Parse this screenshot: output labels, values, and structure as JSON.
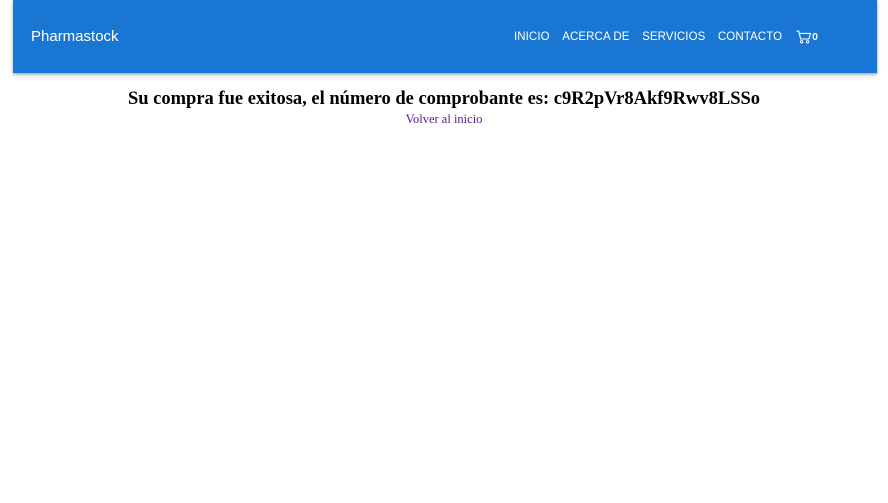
{
  "navbar": {
    "brand": "Pharmastock",
    "links": [
      {
        "label": "INICIO"
      },
      {
        "label": "ACERCA DE"
      },
      {
        "label": "SERVICIOS"
      },
      {
        "label": "CONTACTO"
      }
    ],
    "cart": {
      "icon": "cart-icon",
      "count": "0"
    }
  },
  "main": {
    "message": "Su compra fue exitosa, el número de comprobante es: c9R2pVr8Akf9Rwv8LSSo",
    "back_link": "Volver al inicio"
  },
  "colors": {
    "navbar_bg": "#1976d2",
    "visited_link": "#551a8b"
  }
}
